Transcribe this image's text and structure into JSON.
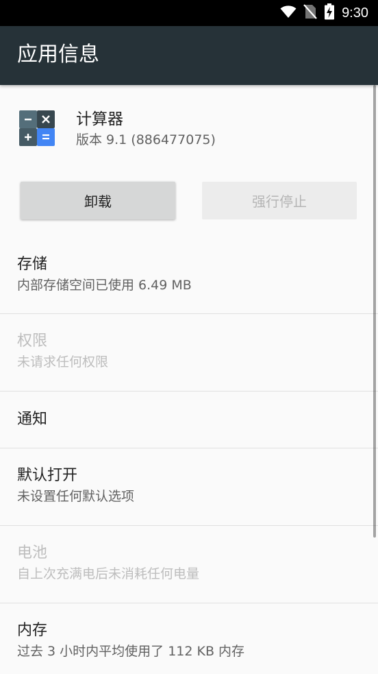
{
  "status_bar": {
    "time": "9:30",
    "icons": [
      "wifi-icon",
      "no-sim-icon",
      "battery-charging-icon"
    ]
  },
  "app_bar": {
    "title": "应用信息"
  },
  "app": {
    "name": "计算器",
    "version": "版本 9.1 (886477075)",
    "icon": "calculator-icon"
  },
  "buttons": {
    "uninstall": "卸载",
    "force_stop": "强行停止"
  },
  "rows": [
    {
      "id": "storage",
      "title": "存储",
      "subtitle": "内部存储空间已使用 6.49 MB",
      "enabled": true
    },
    {
      "id": "permissions",
      "title": "权限",
      "subtitle": "未请求任何权限",
      "enabled": false
    },
    {
      "id": "notifications",
      "title": "通知",
      "subtitle": "",
      "enabled": true
    },
    {
      "id": "open-by-default",
      "title": "默认打开",
      "subtitle": "未设置任何默认选项",
      "enabled": true
    },
    {
      "id": "battery",
      "title": "电池",
      "subtitle": "自上次充满电后未消耗任何电量",
      "enabled": false
    },
    {
      "id": "memory",
      "title": "内存",
      "subtitle": "过去 3 小时内平均使用了 112 KB 内存",
      "enabled": true
    }
  ],
  "colors": {
    "status_bar": "#000000",
    "app_bar": "#263238",
    "background": "#fafafa",
    "icon_dark": "#455a64",
    "icon_accent": "#4285f4"
  }
}
